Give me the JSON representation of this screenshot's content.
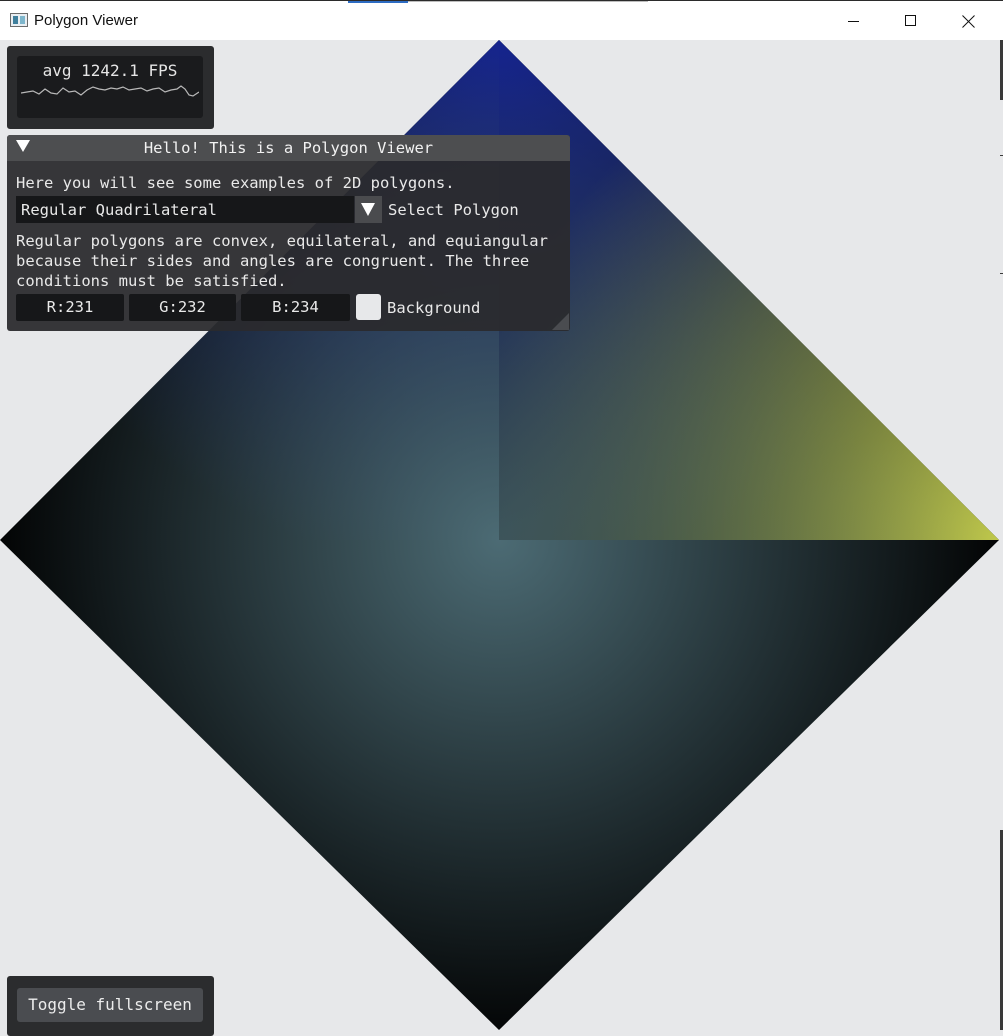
{
  "window": {
    "title": "Polygon Viewer",
    "controls": [
      "minimize",
      "maximize",
      "close"
    ],
    "background_color": "#e7e8ea"
  },
  "fps_overlay": {
    "text": "avg 1242.1 FPS"
  },
  "panel": {
    "title": "Hello! This is a Polygon Viewer",
    "intro": "Here you will see some examples of 2D polygons.",
    "select": {
      "value": "Regular Quadrilateral",
      "label": "Select Polygon"
    },
    "description_lines": [
      "Regular polygons are convex, equilateral, and equiangular",
      "because their sides and angles are congruent. The three",
      "conditions must be satisfied."
    ],
    "color": {
      "r_label": "R:231",
      "g_label": "G:232",
      "b_label": "B:234",
      "swatch_color": "#e7e8ea",
      "label": "Background"
    }
  },
  "fullscreen_button": {
    "label": "Toggle fullscreen"
  },
  "polygon": {
    "name": "Regular Quadrilateral",
    "sides": 4,
    "vertex_colors": {
      "top": "#13218f",
      "right": "#c3cb4a",
      "bottom": "#000000",
      "left": "#000000",
      "center": "#4c6b74"
    }
  },
  "icons": [
    "app-icon",
    "minimize-icon",
    "maximize-icon",
    "close-icon",
    "collapse-arrow-icon",
    "dropdown-arrow-icon"
  ]
}
